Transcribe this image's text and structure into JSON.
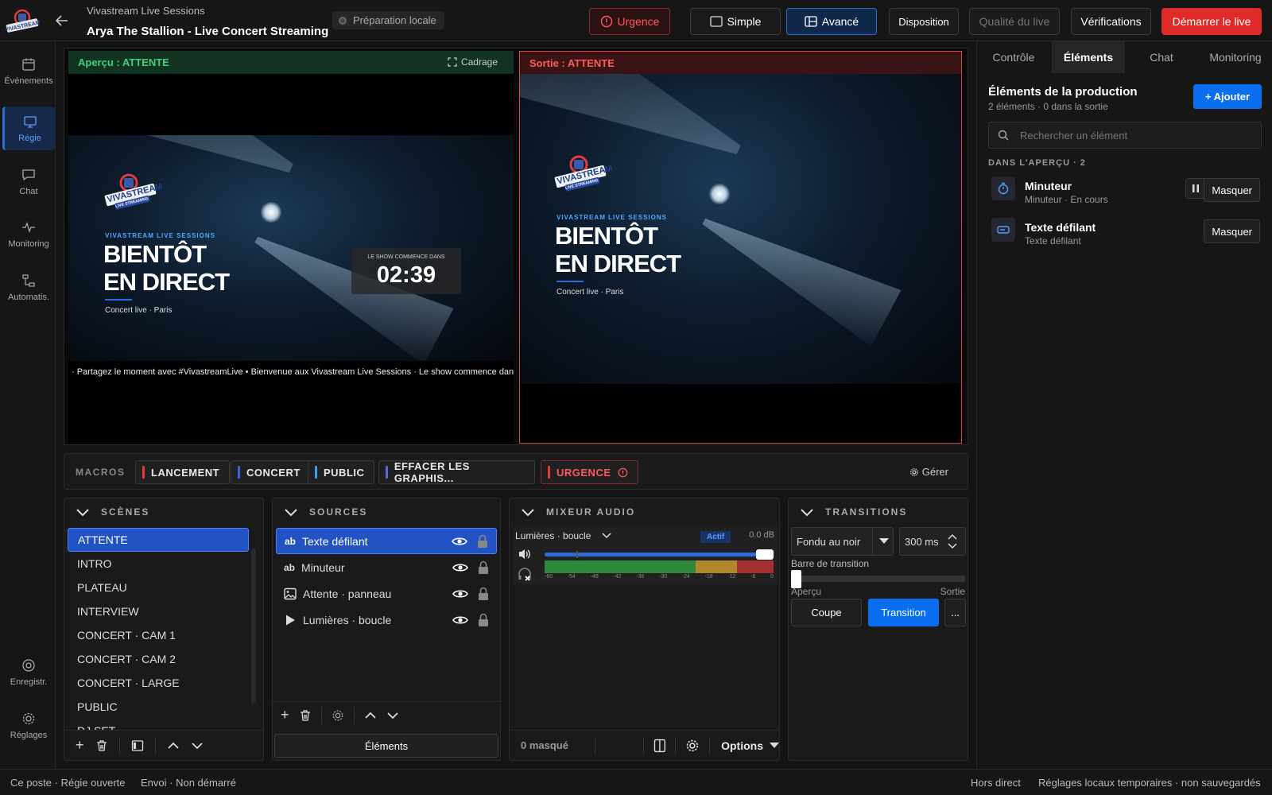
{
  "header": {
    "app_name": "Vivastream Live Sessions",
    "event_title": "Arya The Stallion - Live Concert Streaming",
    "local_badge": "Préparation locale",
    "urgence": "Urgence",
    "mode_simple": "Simple",
    "mode_advanced": "Avancé",
    "layout": "Disposition",
    "quality": "Qualité du live",
    "checks": "Vérifications",
    "start": "Démarrer le live"
  },
  "nav": [
    {
      "label": "Événements",
      "icon": "calendar-icon"
    },
    {
      "label": "Régie",
      "icon": "monitor-icon"
    },
    {
      "label": "Chat",
      "icon": "chat-icon"
    },
    {
      "label": "Monitoring",
      "icon": "pulse-icon"
    },
    {
      "label": "Automatis.",
      "icon": "automation-icon"
    },
    {
      "label": "Enregistr.",
      "icon": "record-icon"
    },
    {
      "label": "Réglages",
      "icon": "gear-icon"
    }
  ],
  "preview": {
    "label": "Aperçu : ATTENTE",
    "crop": "Cadrage",
    "overlay_sub": "VIVASTREAM LIVE SESSIONS",
    "overlay_line1": "BIENTÔT",
    "overlay_line2": "EN DIRECT",
    "overlay_place": "Concert live · Paris",
    "logo_text": "VIVASTREAM",
    "logo_sub": "LIVE STREAMING",
    "timer_label": "LE SHOW COMMENCE DANS",
    "timer_value": "02:39",
    "ticker": "· Partagez le moment avec #VivastreamLive   •   Bienvenue aux Vivastream Live Sessions · Le show commence dans c"
  },
  "output": {
    "label": "Sortie : ATTENTE"
  },
  "macros": {
    "label": "MACROS",
    "items": [
      {
        "label": "LANCEMENT",
        "color": "#e23b3b"
      },
      {
        "label": "CONCERT",
        "color": "#2f6ad8"
      },
      {
        "label": "PUBLIC",
        "color": "#3aa0e8"
      },
      {
        "label": "EFFACER LES GRAPHIS...",
        "color": "#5a6ad8"
      },
      {
        "label": "URGENCE",
        "color": "#e23b3b"
      }
    ],
    "manage": "Gérer"
  },
  "scenes": {
    "title": "SCÈNES",
    "items": [
      "ATTENTE",
      "INTRO",
      "PLATEAU",
      "INTERVIEW",
      "CONCERT · CAM 1",
      "CONCERT · CAM 2",
      "CONCERT · LARGE",
      "PUBLIC",
      "DJ SET"
    ]
  },
  "sources": {
    "title": "SOURCES",
    "items": [
      {
        "label": "Texte défilant",
        "icon": "text-icon"
      },
      {
        "label": "Minuteur",
        "icon": "text-icon"
      },
      {
        "label": "Attente · panneau",
        "icon": "image-icon"
      },
      {
        "label": "Lumières · boucle",
        "icon": "play-icon"
      }
    ],
    "elements_button": "Éléments"
  },
  "audio": {
    "title": "MIXEUR AUDIO",
    "channel": "Lumières · boucle",
    "active_badge": "Actif",
    "db": "0.0 dB",
    "scale": [
      "-60",
      "-54",
      "-48",
      "-42",
      "-36",
      "-30",
      "-24",
      "-18",
      "-12",
      "-6",
      "0"
    ],
    "volume": 1.0,
    "hidden_count": "0 masqué",
    "options": "Options"
  },
  "transitions": {
    "title": "TRANSITIONS",
    "type": "Fondu au noir",
    "duration": "300 ms",
    "bar_label": "Barre de transition",
    "preview_label": "Aperçu",
    "output_label": "Sortie",
    "cut": "Coupe",
    "transition": "Transition",
    "more": "..."
  },
  "right": {
    "tabs": [
      "Contrôle",
      "Éléments",
      "Chat",
      "Monitoring"
    ],
    "title": "Éléments de la production",
    "subtitle": "2 éléments · 0 dans la sortie",
    "add": "+ Ajouter",
    "search_placeholder": "Rechercher un élément",
    "section": "DANS L'APERÇU · 2",
    "elements": [
      {
        "name": "Minuteur",
        "status": "Minuteur · En cours",
        "action": "Masquer",
        "icon": "timer-icon"
      },
      {
        "name": "Texte défilant",
        "status": "Texte défilant",
        "action": "Masquer",
        "icon": "ticker-icon"
      }
    ]
  },
  "status": {
    "station": "Ce poste · Régie ouverte",
    "send": "Envoi · Non démarré",
    "live": "Hors direct",
    "settings": "Réglages locaux temporaires · non sauvegardés"
  },
  "colors": {
    "accent": "#2f6ad8",
    "danger": "#e02a2a",
    "preview_green": "#3fd17a"
  }
}
